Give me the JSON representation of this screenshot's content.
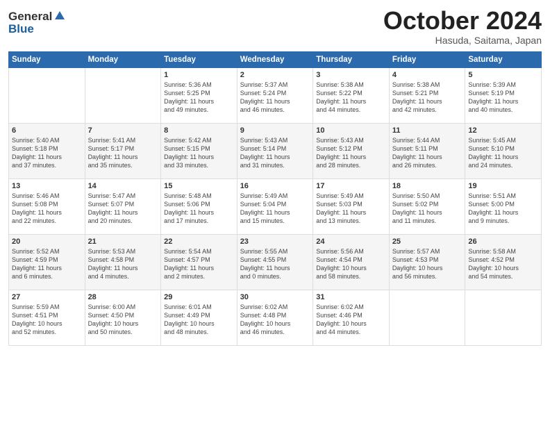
{
  "header": {
    "logo_line1": "General",
    "logo_line2": "Blue",
    "month": "October 2024",
    "location": "Hasuda, Saitama, Japan"
  },
  "weekdays": [
    "Sunday",
    "Monday",
    "Tuesday",
    "Wednesday",
    "Thursday",
    "Friday",
    "Saturday"
  ],
  "weeks": [
    [
      {
        "day": "",
        "info": ""
      },
      {
        "day": "",
        "info": ""
      },
      {
        "day": "1",
        "info": "Sunrise: 5:36 AM\nSunset: 5:25 PM\nDaylight: 11 hours\nand 49 minutes."
      },
      {
        "day": "2",
        "info": "Sunrise: 5:37 AM\nSunset: 5:24 PM\nDaylight: 11 hours\nand 46 minutes."
      },
      {
        "day": "3",
        "info": "Sunrise: 5:38 AM\nSunset: 5:22 PM\nDaylight: 11 hours\nand 44 minutes."
      },
      {
        "day": "4",
        "info": "Sunrise: 5:38 AM\nSunset: 5:21 PM\nDaylight: 11 hours\nand 42 minutes."
      },
      {
        "day": "5",
        "info": "Sunrise: 5:39 AM\nSunset: 5:19 PM\nDaylight: 11 hours\nand 40 minutes."
      }
    ],
    [
      {
        "day": "6",
        "info": "Sunrise: 5:40 AM\nSunset: 5:18 PM\nDaylight: 11 hours\nand 37 minutes."
      },
      {
        "day": "7",
        "info": "Sunrise: 5:41 AM\nSunset: 5:17 PM\nDaylight: 11 hours\nand 35 minutes."
      },
      {
        "day": "8",
        "info": "Sunrise: 5:42 AM\nSunset: 5:15 PM\nDaylight: 11 hours\nand 33 minutes."
      },
      {
        "day": "9",
        "info": "Sunrise: 5:43 AM\nSunset: 5:14 PM\nDaylight: 11 hours\nand 31 minutes."
      },
      {
        "day": "10",
        "info": "Sunrise: 5:43 AM\nSunset: 5:12 PM\nDaylight: 11 hours\nand 28 minutes."
      },
      {
        "day": "11",
        "info": "Sunrise: 5:44 AM\nSunset: 5:11 PM\nDaylight: 11 hours\nand 26 minutes."
      },
      {
        "day": "12",
        "info": "Sunrise: 5:45 AM\nSunset: 5:10 PM\nDaylight: 11 hours\nand 24 minutes."
      }
    ],
    [
      {
        "day": "13",
        "info": "Sunrise: 5:46 AM\nSunset: 5:08 PM\nDaylight: 11 hours\nand 22 minutes."
      },
      {
        "day": "14",
        "info": "Sunrise: 5:47 AM\nSunset: 5:07 PM\nDaylight: 11 hours\nand 20 minutes."
      },
      {
        "day": "15",
        "info": "Sunrise: 5:48 AM\nSunset: 5:06 PM\nDaylight: 11 hours\nand 17 minutes."
      },
      {
        "day": "16",
        "info": "Sunrise: 5:49 AM\nSunset: 5:04 PM\nDaylight: 11 hours\nand 15 minutes."
      },
      {
        "day": "17",
        "info": "Sunrise: 5:49 AM\nSunset: 5:03 PM\nDaylight: 11 hours\nand 13 minutes."
      },
      {
        "day": "18",
        "info": "Sunrise: 5:50 AM\nSunset: 5:02 PM\nDaylight: 11 hours\nand 11 minutes."
      },
      {
        "day": "19",
        "info": "Sunrise: 5:51 AM\nSunset: 5:00 PM\nDaylight: 11 hours\nand 9 minutes."
      }
    ],
    [
      {
        "day": "20",
        "info": "Sunrise: 5:52 AM\nSunset: 4:59 PM\nDaylight: 11 hours\nand 6 minutes."
      },
      {
        "day": "21",
        "info": "Sunrise: 5:53 AM\nSunset: 4:58 PM\nDaylight: 11 hours\nand 4 minutes."
      },
      {
        "day": "22",
        "info": "Sunrise: 5:54 AM\nSunset: 4:57 PM\nDaylight: 11 hours\nand 2 minutes."
      },
      {
        "day": "23",
        "info": "Sunrise: 5:55 AM\nSunset: 4:55 PM\nDaylight: 11 hours\nand 0 minutes."
      },
      {
        "day": "24",
        "info": "Sunrise: 5:56 AM\nSunset: 4:54 PM\nDaylight: 10 hours\nand 58 minutes."
      },
      {
        "day": "25",
        "info": "Sunrise: 5:57 AM\nSunset: 4:53 PM\nDaylight: 10 hours\nand 56 minutes."
      },
      {
        "day": "26",
        "info": "Sunrise: 5:58 AM\nSunset: 4:52 PM\nDaylight: 10 hours\nand 54 minutes."
      }
    ],
    [
      {
        "day": "27",
        "info": "Sunrise: 5:59 AM\nSunset: 4:51 PM\nDaylight: 10 hours\nand 52 minutes."
      },
      {
        "day": "28",
        "info": "Sunrise: 6:00 AM\nSunset: 4:50 PM\nDaylight: 10 hours\nand 50 minutes."
      },
      {
        "day": "29",
        "info": "Sunrise: 6:01 AM\nSunset: 4:49 PM\nDaylight: 10 hours\nand 48 minutes."
      },
      {
        "day": "30",
        "info": "Sunrise: 6:02 AM\nSunset: 4:48 PM\nDaylight: 10 hours\nand 46 minutes."
      },
      {
        "day": "31",
        "info": "Sunrise: 6:02 AM\nSunset: 4:46 PM\nDaylight: 10 hours\nand 44 minutes."
      },
      {
        "day": "",
        "info": ""
      },
      {
        "day": "",
        "info": ""
      }
    ]
  ]
}
